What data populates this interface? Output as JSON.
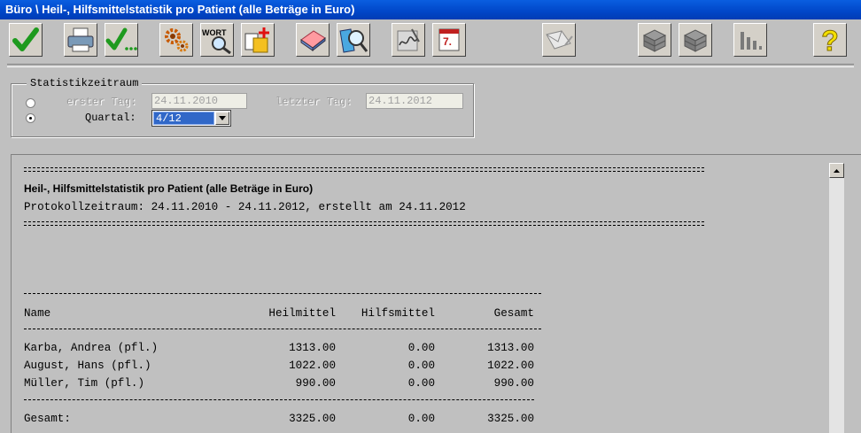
{
  "window": {
    "title": "Büro \\ Heil-, Hilfsmittelstatistik pro Patient (alle Beträge in Euro)"
  },
  "toolbar": {
    "buttons": [
      {
        "icon": "checkmark-icon"
      },
      {
        "icon": "printer-icon"
      },
      {
        "icon": "check-dots-icon"
      },
      {
        "icon": "gears-icon"
      },
      {
        "icon": "word-export-icon",
        "label": "WORT"
      },
      {
        "icon": "copy-document-icon"
      },
      {
        "icon": "eraser-icon"
      },
      {
        "icon": "magnifier-icon"
      },
      {
        "icon": "signature-icon"
      },
      {
        "icon": "calendar-icon",
        "label": "7."
      },
      {
        "icon": "envelope-icon"
      },
      {
        "icon": "stack-icon"
      },
      {
        "icon": "stack-icon"
      },
      {
        "icon": "bar-chart-icon"
      },
      {
        "icon": "help-icon",
        "label": "?"
      }
    ]
  },
  "period": {
    "legend": "Statistikzeitraum",
    "first_day_label": "erster Tag:",
    "first_day_value": "24.11.2010",
    "last_day_label": "letzter Tag:",
    "last_day_value": "24.11.2012",
    "quarter_label": "Quartal:",
    "quarter_value": "4/12",
    "selected": "quartal"
  },
  "report": {
    "title": "Heil-, Hilfsmittelstatistik pro Patient (alle Beträge in Euro)",
    "period_line": "Protokollzeitraum: 24.11.2010 - 24.11.2012, erstellt am 24.11.2012",
    "columns": [
      "Name",
      "Heilmittel",
      "Hilfsmittel",
      "Gesamt"
    ],
    "rows": [
      {
        "name": "Karba, Andrea (pfl.)",
        "heilmittel": "1313.00",
        "hilfsmittel": "0.00",
        "gesamt": "1313.00"
      },
      {
        "name": "August, Hans (pfl.)",
        "heilmittel": "1022.00",
        "hilfsmittel": "0.00",
        "gesamt": "1022.00"
      },
      {
        "name": "Müller, Tim (pfl.)",
        "heilmittel": "990.00",
        "hilfsmittel": "0.00",
        "gesamt": "990.00"
      }
    ],
    "total": {
      "name": "Gesamt:",
      "heilmittel": "3325.00",
      "hilfsmittel": "0.00",
      "gesamt": "3325.00"
    }
  },
  "colors": {
    "title_bar": "#0046c8",
    "selection": "#3168c8",
    "background": "#c0c0c0",
    "check_green": "#1e9a1e",
    "help_yellow": "#f4e000"
  }
}
